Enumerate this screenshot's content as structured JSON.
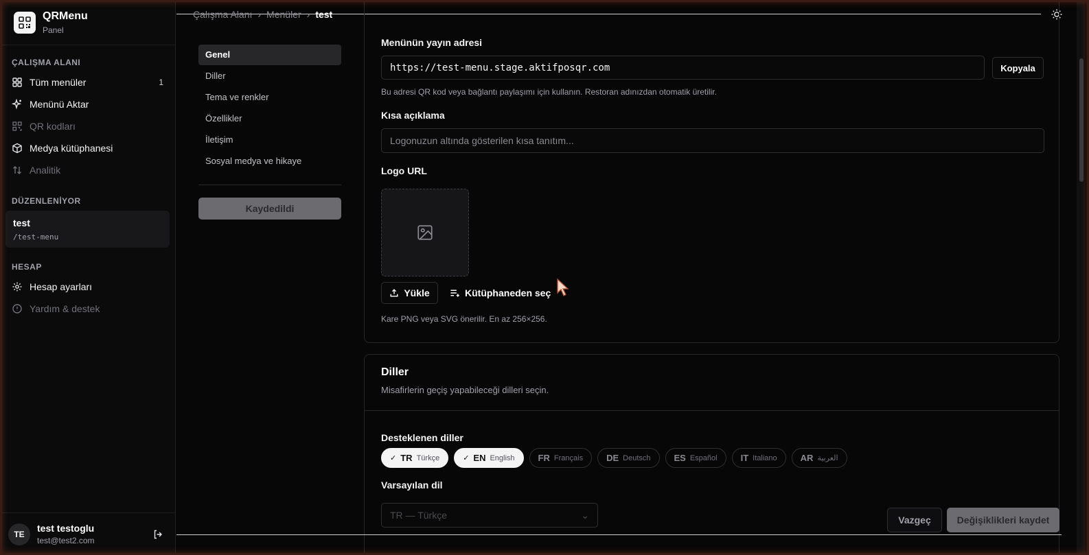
{
  "brand": {
    "name": "QRMenu",
    "subtitle": "Panel"
  },
  "sidebar": {
    "workspace_label": "ÇALIŞMA ALANI",
    "workspace_items": [
      {
        "label": "Tüm menüler",
        "icon": "grid-icon",
        "count": "1"
      },
      {
        "label": "Menünü Aktar",
        "icon": "sparkle-icon"
      },
      {
        "label": "QR kodları",
        "icon": "qr-icon"
      },
      {
        "label": "Medya kütüphanesi",
        "icon": "box-icon"
      },
      {
        "label": "Analitik",
        "icon": "sort-icon"
      }
    ],
    "editing_label": "DÜZENLENİYOR",
    "editing": {
      "name": "test",
      "slug": "/test-menu"
    },
    "account_label": "HESAP",
    "account_items": [
      {
        "label": "Hesap ayarları",
        "icon": "gear-icon"
      },
      {
        "label": "Yardım & destek",
        "icon": "help-icon"
      }
    ]
  },
  "user": {
    "initials": "TE",
    "name": "test testoglu",
    "email": "test@test2.com"
  },
  "breadcrumb": {
    "items": [
      "Çalışma Alanı",
      "Menüler"
    ],
    "current": "test",
    "separator": "›"
  },
  "settings_nav": {
    "items": [
      "Genel",
      "Diller",
      "Tema ve renkler",
      "Özellikler",
      "İletişim",
      "Sosyal medya ve hikaye"
    ],
    "active": "Genel",
    "saved_label": "Kaydedildi"
  },
  "general": {
    "url_label": "Menünün yayın adresi",
    "url_value": "https://test-menu.stage.aktifposqr.com",
    "copy_label": "Kopyala",
    "url_hint": "Bu adresi QR kod veya bağlantı paylaşımı için kullanın. Restoran adınızdan otomatik üretilir.",
    "short_desc_label": "Kısa açıklama",
    "short_desc_placeholder": "Logonuzun altında gösterilen kısa tanıtım...",
    "logo_label": "Logo URL",
    "upload_label": "Yükle",
    "library_label": "Kütüphaneden seç",
    "logo_hint": "Kare PNG veya SVG önerilir. En az 256×256."
  },
  "languages": {
    "title": "Diller",
    "subtitle": "Misafirlerin geçiş yapabileceği dilleri seçin.",
    "supported_label": "Desteklenen diller",
    "chips": [
      {
        "code": "TR",
        "name": "Türkçe",
        "selected": true
      },
      {
        "code": "EN",
        "name": "English",
        "selected": true
      },
      {
        "code": "FR",
        "name": "Français",
        "selected": false
      },
      {
        "code": "DE",
        "name": "Deutsch",
        "selected": false
      },
      {
        "code": "ES",
        "name": "Español",
        "selected": false
      },
      {
        "code": "IT",
        "name": "Italiano",
        "selected": false
      },
      {
        "code": "AR",
        "name": "العربية",
        "selected": false
      }
    ],
    "default_label": "Varsayılan dil",
    "default_value": "TR — Türkçe"
  },
  "actions": {
    "cancel": "Vazgeç",
    "save": "Değişiklikleri kaydet"
  }
}
